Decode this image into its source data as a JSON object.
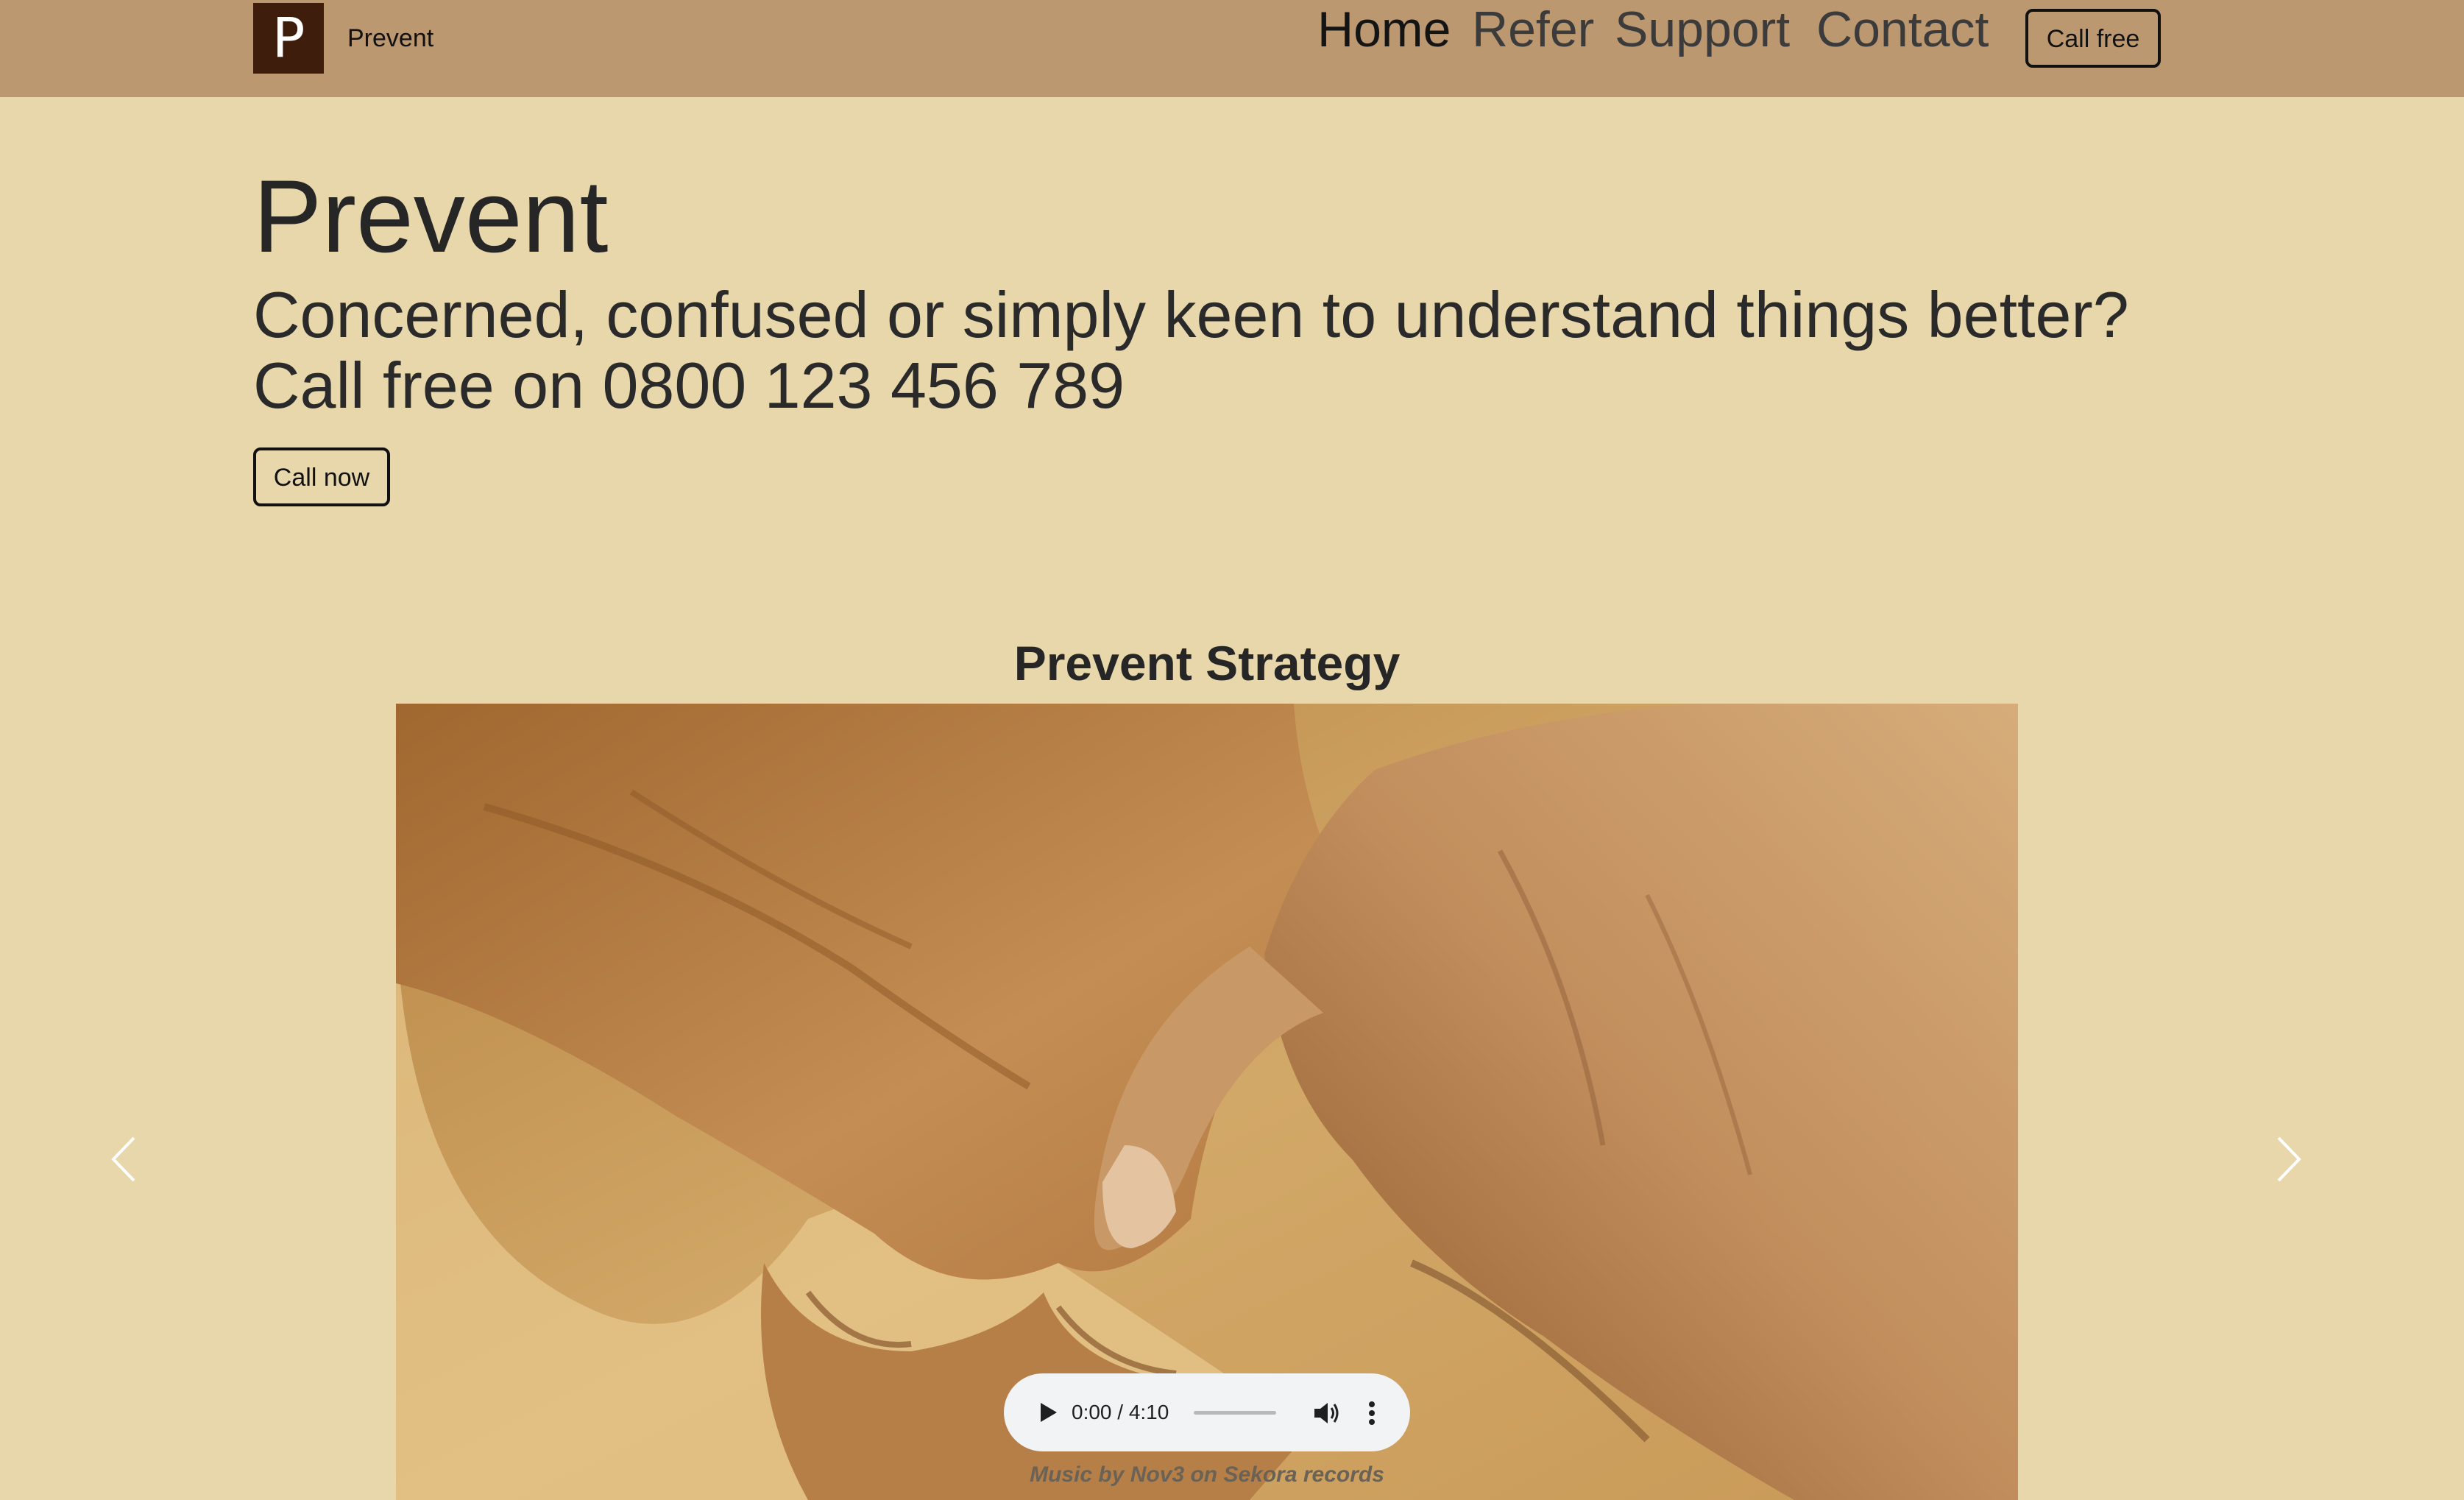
{
  "header": {
    "logo_letter": "P",
    "brand": "Prevent",
    "nav": [
      {
        "label": "Home",
        "active": true
      },
      {
        "label": "Refer",
        "active": false
      },
      {
        "label": "Support",
        "active": false
      },
      {
        "label": "Contact",
        "active": false
      }
    ],
    "call_button": "Call free"
  },
  "hero": {
    "title": "Prevent",
    "subtitle_line1": "Concerned, confused or simply keen to understand things better?",
    "subtitle_line2": "Call free on 0800 123 456 789",
    "call_button": "Call now"
  },
  "section": {
    "title": "Prevent Strategy",
    "image_alt": "Two hands clasped together",
    "prev_icon": "chevron-left-icon",
    "next_icon": "chevron-right-icon"
  },
  "audio": {
    "time": "0:00 / 4:10",
    "progress": 0,
    "icons": [
      "play-icon",
      "volume-icon",
      "more-vertical-icon"
    ],
    "credit": "Music by Nov3 on Sekora records"
  },
  "colors": {
    "page_background": "#e7d7ab",
    "navbar_background": "#bb9870",
    "logo_background": "#3f1d0d"
  }
}
